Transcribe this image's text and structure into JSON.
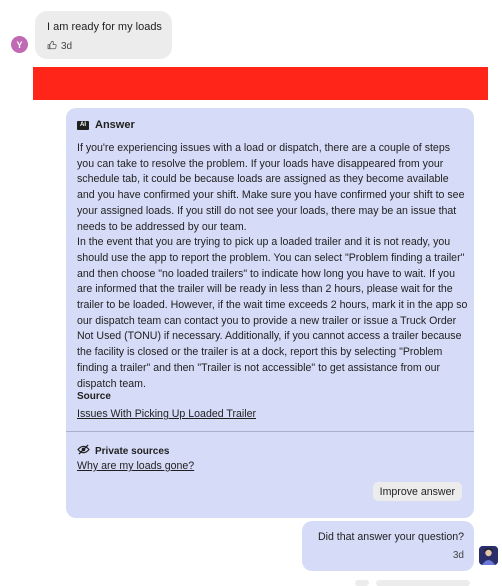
{
  "user_message": {
    "avatar_initial": "Y",
    "text": "I am ready for my loads",
    "time": "3d",
    "icon": "thumbs-up-outline-icon"
  },
  "colors": {
    "redaction": "#ff2518",
    "answer_bg": "#d6dcf7",
    "user_bubble_bg": "#ececec"
  },
  "answer": {
    "badge": "AI",
    "title": "Answer",
    "paragraphs": [
      "If you're experiencing issues with a load or dispatch, there are a couple of steps you can take to resolve the problem. If your loads have disappeared from your schedule tab, it could be because loads are assigned as they become available and you have confirmed your shift. Make sure you have confirmed your shift to see your assigned loads. If you still do not see your loads, there may be an issue that needs to be addressed by our team.",
      "In the event that you are trying to pick up a loaded trailer and it is not ready, you should use the app to report the problem. You can select \"Problem finding a trailer\" and then choose \"no loaded trailers\" to indicate how long you have to wait. If you are informed that the trailer will be ready in less than 2 hours, please wait for the trailer to be loaded. However, if the wait time exceeds 2 hours, mark it in the app so our dispatch team can contact you to provide a new trailer or issue a Truck Order Not Used (TONU) if necessary. Additionally, if you cannot access a trailer because the facility is closed or the trailer is at a dock, report this by selecting \"Problem finding a trailer\" and then \"Trailer is not accessible\" to get assistance from our dispatch team."
    ],
    "source_label": "Source",
    "source_link": "Issues With Picking Up Loaded Trailer",
    "private_label": "Private sources",
    "private_icon": "eye-off-icon",
    "private_link": "Why are my loads gone?",
    "improve_button": "Improve answer"
  },
  "followup": {
    "text": "Did that answer your question?",
    "time": "3d"
  }
}
